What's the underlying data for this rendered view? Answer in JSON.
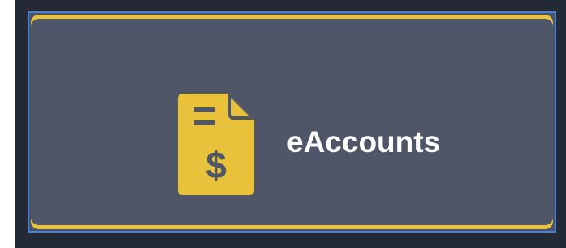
{
  "tile": {
    "label": "eAccounts",
    "icon": "invoice-dollar-icon",
    "accent_color": "#e9c23b",
    "background_color": "#4e5668",
    "selection_border_color": "#4a7fd4"
  }
}
